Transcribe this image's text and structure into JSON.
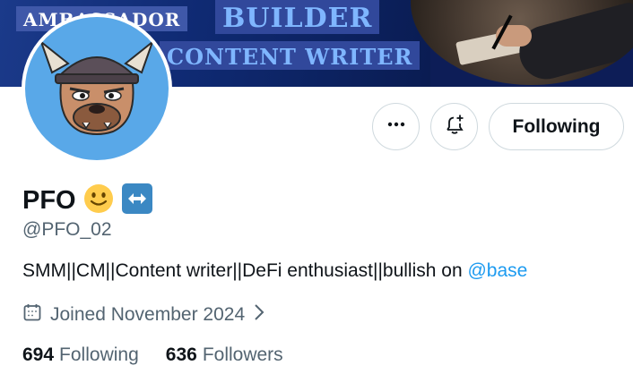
{
  "banner": {
    "tag_ambassador": "AMBASSADOR",
    "tag_builder": "BUILDER",
    "tag_writer": "CONTENT WRITER"
  },
  "avatar": {
    "icon": "bulldog-viking-avatar"
  },
  "actions": {
    "more_icon": "more-horizontal-icon",
    "notify_icon": "bell-plus-icon",
    "following_label": "Following"
  },
  "profile": {
    "display_name": "PFO",
    "name_emojis": [
      "slightly-smiling-face-emoji",
      "left-right-arrow-emoji"
    ],
    "handle": "@PFO_02",
    "bio_text": "SMM||CM||Content writer||DeFi enthusiast||bullish on ",
    "bio_link": "@base",
    "joined": "Joined November 2024"
  },
  "stats": {
    "following_count": "694",
    "following_label": "Following",
    "followers_count": "636",
    "followers_label": "Followers"
  },
  "colors": {
    "text_primary": "#0f1419",
    "text_secondary": "#536471",
    "link": "#1d9bf0",
    "border": "#cfd9de"
  }
}
